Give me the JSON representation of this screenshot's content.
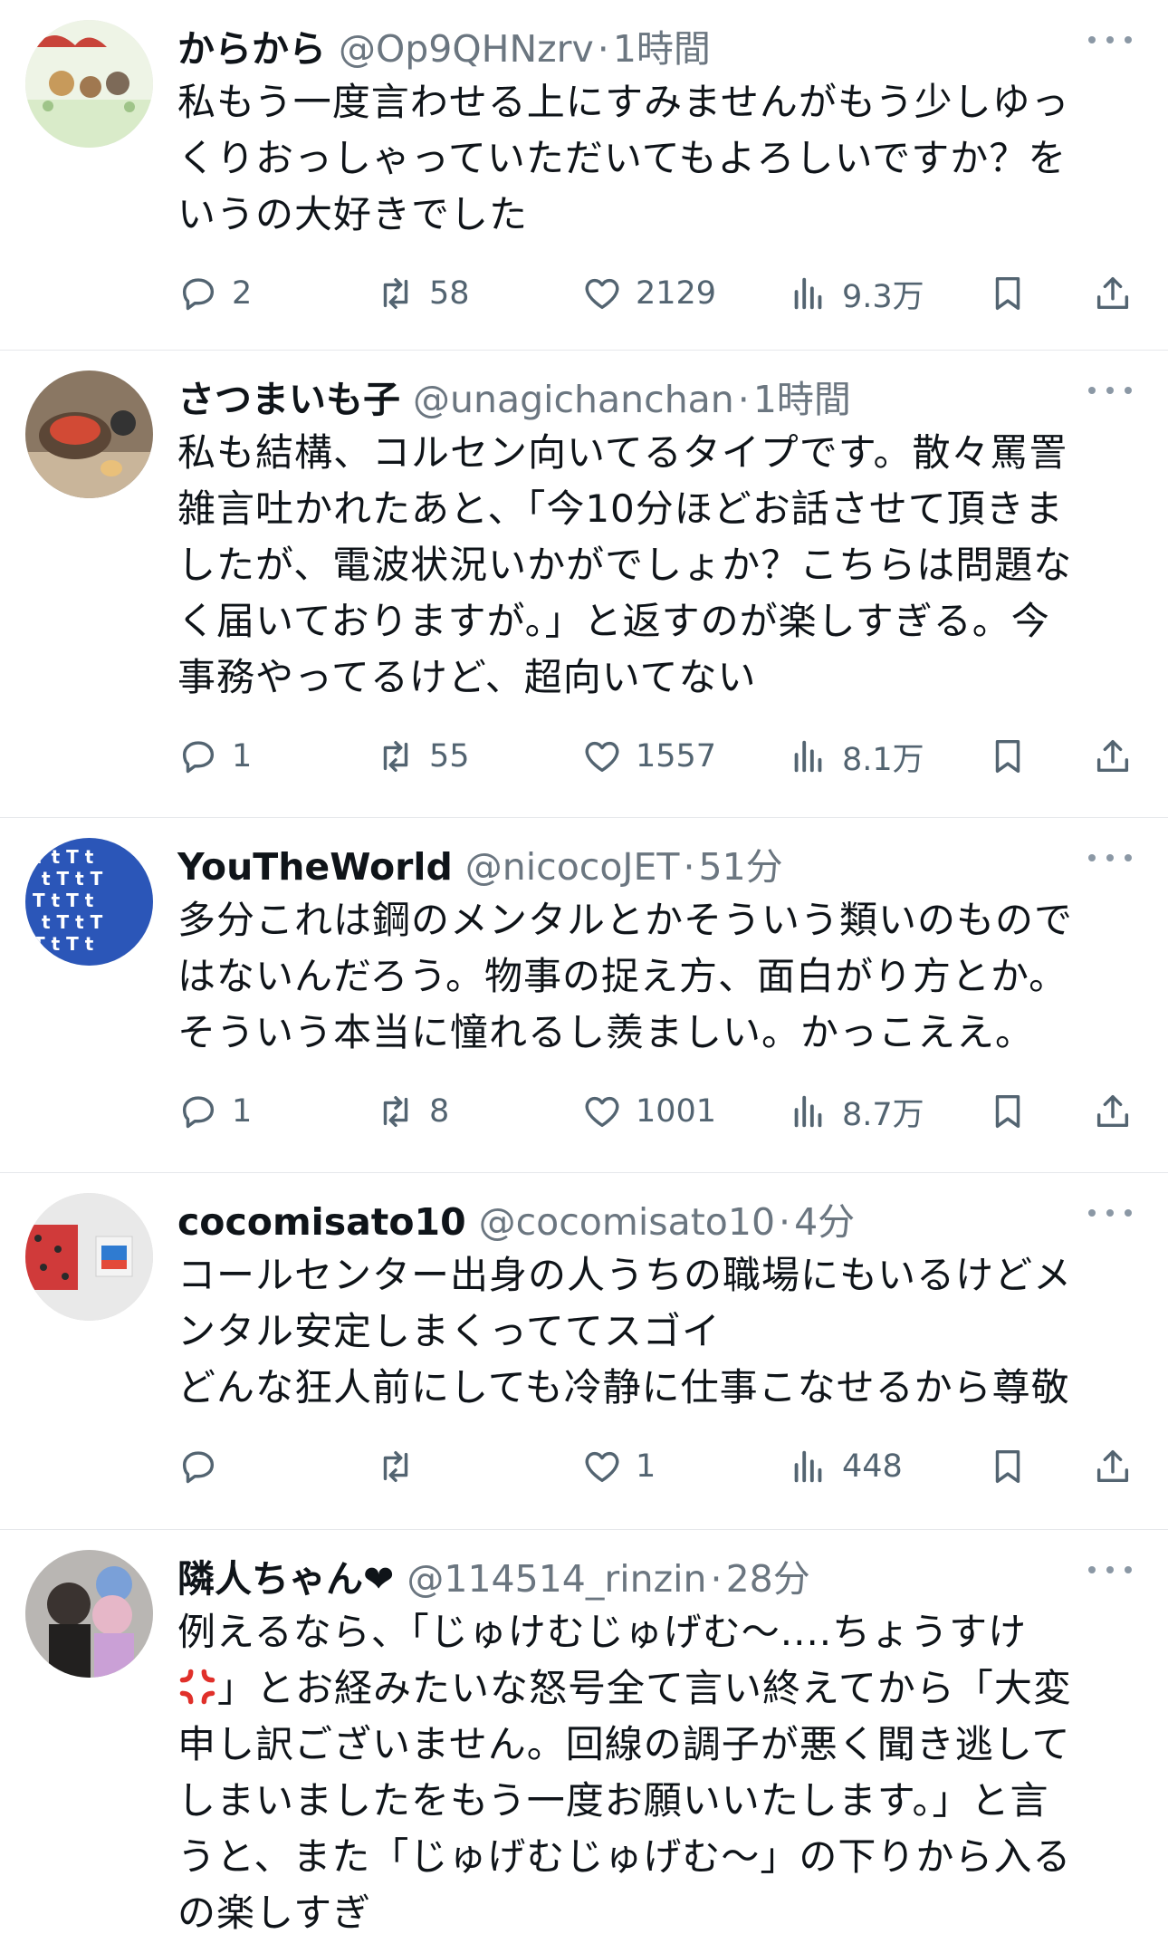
{
  "tweets": [
    {
      "name": "からから",
      "handle": "@Op9QHNzrv",
      "sep": "·",
      "time": "1時間",
      "text": "私もう一度言わせる上にすみませんがもう少しゆっ\nくりおっしゃっていただいてもよろしいですか？を\nいうの大好きでした",
      "replies": "2",
      "retweets": "58",
      "likes": "2129",
      "views": "9.3万"
    },
    {
      "name": "さつまいも子",
      "handle": "@unagichanchan",
      "sep": "·",
      "time": "1時間",
      "text": "私も結構、コルセン向いてるタイプです。散々罵詈\n雑言吐かれたあと、「今10分ほどお話させて頂きま\nしたが、電波状況いかがでしょか？こちらは問題な\nく届いておりますが。」と返すのが楽しすぎる。今\n事務やってるけど、超向いてない",
      "replies": "1",
      "retweets": "55",
      "likes": "1557",
      "views": "8.1万"
    },
    {
      "name": "YouTheWorld",
      "handle": "@nicocoJET",
      "sep": "·",
      "time": "51分",
      "text": "多分これは鋼のメンタルとかそういう類いのもので\nはないんだろう。物事の捉え方、面白がり方とか。\nそういう本当に憧れるし羨ましい。かっこええ。",
      "replies": "1",
      "retweets": "8",
      "likes": "1001",
      "views": "8.7万"
    },
    {
      "name": "cocomisato10",
      "handle": "@cocomisato10",
      "sep": "·",
      "time": "4分",
      "text": "コールセンター出身の人うちの職場にもいるけどメ\nンタル安定しまくっててスゴイ\nどんな狂人前にしても冷静に仕事こなせるから尊敬",
      "replies": "",
      "retweets": "",
      "likes": "1",
      "views": "448"
    },
    {
      "name": "隣人ちゃん❤",
      "handle": "@114514_rinzin",
      "sep": "·",
      "time": "28分",
      "text_before_emoji": "例えるなら、「じゅけむじゅげむ〜....ちょうすけ\n",
      "emoji": "anger-symbol-icon",
      "text_after_emoji": "」とお経みたいな怒号全て言い終えてから「大変\n申し訳ございません。回線の調子が悪く聞き逃して\nしまいましたをもう一度お願いいたします。」と言\nうと、また「じゅげむじゅげむ〜」の下りから入る\nの楽しすぎ"
    }
  ],
  "icons": {
    "reply": "reply-icon",
    "retweet": "retweet-icon",
    "like": "heart-icon",
    "views": "views-chart-icon",
    "bookmark": "bookmark-icon",
    "share": "share-icon",
    "more": "more-dots-icon"
  },
  "colors": {
    "text": "#0f1419",
    "muted": "#6b7680",
    "action": "#536471",
    "divider": "#e6e8eb",
    "anger_red": "#e0302a"
  }
}
